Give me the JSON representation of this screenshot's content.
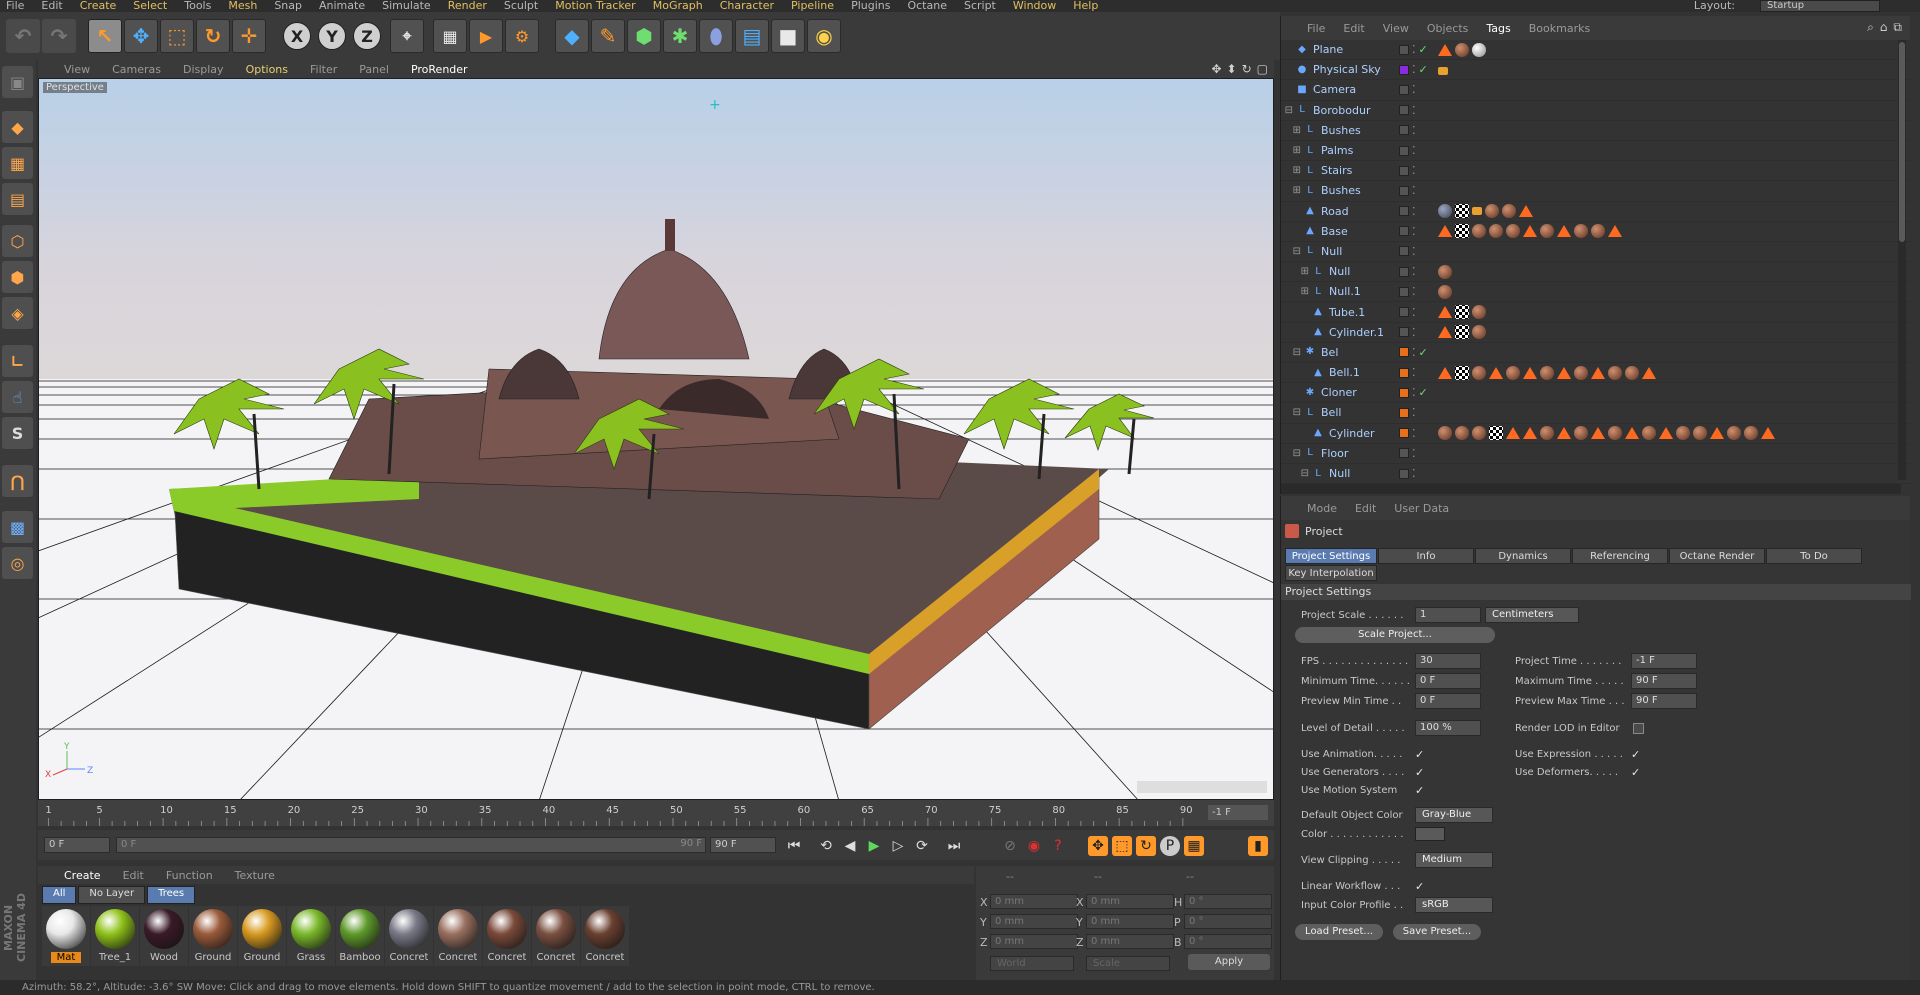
{
  "menubar": {
    "items": [
      {
        "label": "File",
        "hl": false
      },
      {
        "label": "Edit",
        "hl": false
      },
      {
        "label": "Create",
        "hl": true
      },
      {
        "label": "Select",
        "hl": true
      },
      {
        "label": "Tools",
        "hl": false
      },
      {
        "label": "Mesh",
        "hl": true
      },
      {
        "label": "Snap",
        "hl": false
      },
      {
        "label": "Animate",
        "hl": false
      },
      {
        "label": "Simulate",
        "hl": false
      },
      {
        "label": "Render",
        "hl": true
      },
      {
        "label": "Sculpt",
        "hl": false
      },
      {
        "label": "Motion Tracker",
        "hl": true
      },
      {
        "label": "MoGraph",
        "hl": true
      },
      {
        "label": "Character",
        "hl": true
      },
      {
        "label": "Pipeline",
        "hl": true
      },
      {
        "label": "Plugins",
        "hl": false
      },
      {
        "label": "Octane",
        "hl": false
      },
      {
        "label": "Script",
        "hl": false
      },
      {
        "label": "Window",
        "hl": true
      },
      {
        "label": "Help",
        "hl": true
      }
    ],
    "layout_label": "Layout:",
    "layout_value": "Startup"
  },
  "viewport": {
    "menu": [
      "View",
      "Cameras",
      "Display",
      "Options",
      "Filter",
      "Panel",
      "ProRender"
    ],
    "active_menu": "Options",
    "highlight_menu": "ProRender",
    "label": "Perspective"
  },
  "timeline": {
    "ticks": [
      "1",
      "5",
      "10",
      "15",
      "20",
      "25",
      "30",
      "35",
      "40",
      "45",
      "50",
      "55",
      "60",
      "65",
      "70",
      "75",
      "80",
      "85",
      "90"
    ],
    "frame_end": "-1 F",
    "start_field": "0 F",
    "range_start": "0 F",
    "range_end": "90 F",
    "end_field": "90 F"
  },
  "materials": {
    "menu": [
      "Create",
      "Edit",
      "Function",
      "Texture"
    ],
    "filters": [
      "All",
      "No Layer",
      "Trees"
    ],
    "items": [
      {
        "name": "Mat",
        "color": "#e8e8e8"
      },
      {
        "name": "Tree_1",
        "color": "#8fc21a"
      },
      {
        "name": "Wood",
        "color": "#3a1a28"
      },
      {
        "name": "Ground",
        "color": "#9a5a3a"
      },
      {
        "name": "Ground",
        "color": "#d89a20"
      },
      {
        "name": "Grass",
        "color": "#7ab82a"
      },
      {
        "name": "Bamboo",
        "color": "#5e9a2a"
      },
      {
        "name": "Concret",
        "color": "#7a7a88"
      },
      {
        "name": "Concret",
        "color": "#9a7060"
      },
      {
        "name": "Concret",
        "color": "#7a4a3a"
      },
      {
        "name": "Concret",
        "color": "#7a5040"
      },
      {
        "name": "Concret",
        "color": "#6a4030"
      }
    ]
  },
  "coords": {
    "header": [
      "--",
      "--",
      "--"
    ],
    "x_pos": "0 mm",
    "y_pos": "0 mm",
    "z_pos": "0 mm",
    "x_size": "0 mm",
    "y_size": "0 mm",
    "z_size": "0 mm",
    "h_rot": "0 °",
    "p_rot": "0 °",
    "b_rot": "0 °",
    "mode": "World",
    "size_mode": "Scale",
    "apply": "Apply"
  },
  "statusbar": {
    "text": "Azimuth: 58.2°, Altitude: -3.6°  SW     Move: Click and drag to move elements. Hold down SHIFT to quantize movement / add to the selection in point mode, CTRL to remove."
  },
  "objects": {
    "menu": [
      "File",
      "Edit",
      "View",
      "Objects",
      "Tags",
      "Bookmarks"
    ],
    "rows": [
      {
        "name": "Plane",
        "tree": "",
        "icon": "◆",
        "swatch": "",
        "check": "✓",
        "tags": [
          "phong",
          "mat",
          "white"
        ]
      },
      {
        "name": "Physical Sky",
        "tree": "",
        "icon": "●",
        "swatch": "#8a2be2",
        "check": "✓",
        "tags": [
          "sun"
        ]
      },
      {
        "name": "Camera",
        "tree": "",
        "icon": "■",
        "swatch": "",
        "check": "",
        "tags": []
      },
      {
        "name": "Borobodur",
        "tree": "⊟",
        "icon": "L",
        "swatch": "",
        "check": "",
        "tags": []
      },
      {
        "name": "Bushes",
        "tree": "⊞",
        "icon": "L",
        "swatch": "",
        "check": "",
        "tags": []
      },
      {
        "name": "Palms",
        "tree": "⊞",
        "icon": "L",
        "swatch": "",
        "check": "",
        "tags": []
      },
      {
        "name": "Stairs",
        "tree": "⊞",
        "icon": "L",
        "swatch": "",
        "check": "",
        "tags": []
      },
      {
        "name": "Bushes",
        "tree": "⊞",
        "icon": "L",
        "swatch": "",
        "check": "",
        "tags": []
      },
      {
        "name": "Road",
        "tree": "",
        "icon": "▲",
        "swatch": "",
        "check": "",
        "tags": [
          "grey",
          "uv",
          "sun",
          "mat",
          "mat",
          "phong"
        ]
      },
      {
        "name": "Base",
        "tree": "",
        "icon": "▲",
        "swatch": "",
        "check": "",
        "tags": [
          "phong",
          "uv",
          "mat",
          "mat",
          "mat",
          "phong",
          "mat",
          "phong",
          "mat",
          "mat",
          "phong"
        ]
      },
      {
        "name": "Null",
        "tree": "⊟",
        "icon": "L",
        "swatch": "",
        "check": "",
        "tags": []
      },
      {
        "name": "Null",
        "tree": "⊞",
        "icon": "L",
        "swatch": "",
        "check": "",
        "tags": [
          "mat"
        ]
      },
      {
        "name": "Null.1",
        "tree": "⊞",
        "icon": "L",
        "swatch": "",
        "check": "",
        "tags": [
          "mat"
        ]
      },
      {
        "name": "Tube.1",
        "tree": "",
        "icon": "▲",
        "swatch": "",
        "check": "",
        "tags": [
          "phong",
          "uv",
          "mat"
        ]
      },
      {
        "name": "Cylinder.1",
        "tree": "",
        "icon": "▲",
        "swatch": "",
        "check": "",
        "tags": [
          "phong",
          "uv",
          "mat"
        ]
      },
      {
        "name": "Bel",
        "tree": "⊟",
        "icon": "✱",
        "swatch": "#e8701a",
        "check": "✓",
        "tags": []
      },
      {
        "name": "Bell.1",
        "tree": "",
        "icon": "▲",
        "swatch": "#e8701a",
        "check": "",
        "tags": [
          "phong",
          "uv",
          "mat",
          "phong",
          "mat",
          "phong",
          "mat",
          "phong",
          "mat",
          "phong",
          "mat",
          "mat",
          "phong"
        ]
      },
      {
        "name": "Cloner",
        "tree": "",
        "icon": "✱",
        "swatch": "#e8701a",
        "check": "✓",
        "tags": []
      },
      {
        "name": "Bell",
        "tree": "⊟",
        "icon": "L",
        "swatch": "#e8701a",
        "check": "",
        "tags": []
      },
      {
        "name": "Cylinder",
        "tree": "",
        "icon": "▲",
        "swatch": "#e8701a",
        "check": "",
        "tags": [
          "mat",
          "mat",
          "mat",
          "uv",
          "phong",
          "phong",
          "mat",
          "phong",
          "mat",
          "phong",
          "mat",
          "phong",
          "mat",
          "phong",
          "mat",
          "mat",
          "phong",
          "mat",
          "mat",
          "phong"
        ]
      },
      {
        "name": "Floor",
        "tree": "⊟",
        "icon": "L",
        "swatch": "",
        "check": "",
        "tags": []
      },
      {
        "name": "Null",
        "tree": "⊟",
        "icon": "L",
        "swatch": "",
        "check": "",
        "tags": []
      }
    ]
  },
  "attributes": {
    "menu": [
      "Mode",
      "Edit",
      "User Data"
    ],
    "title": "Project",
    "tabs": [
      "Project Settings",
      "Info",
      "Dynamics",
      "Referencing",
      "Octane Render",
      "To Do",
      "Key Interpolation"
    ],
    "section": "Project Settings",
    "project_scale_label": "Project Scale . . . . . .",
    "project_scale_value": "1",
    "project_scale_unit": "Centimeters",
    "scale_project_btn": "Scale Project...",
    "fps_label": "FPS . . . . . . . . . . . . . .",
    "fps_value": "30",
    "project_time_label": "Project Time . . . . . . .",
    "project_time_value": "-1 F",
    "min_time_label": "Minimum Time. . . . . .",
    "min_time_value": "0 F",
    "max_time_label": "Maximum Time . . . . .",
    "max_time_value": "90 F",
    "preview_min_label": "Preview Min Time . .",
    "preview_min_value": "0 F",
    "preview_max_label": "Preview Max Time . . .",
    "preview_max_value": "90 F",
    "lod_label": "Level of Detail . . . . .",
    "lod_value": "100 %",
    "render_lod_label": "Render LOD in Editor",
    "use_animation_label": "Use Animation. . . . .",
    "use_expression_label": "Use Expression . . . . .",
    "use_generators_label": "Use Generators . . . .",
    "use_deformers_label": "Use Deformers. . . . .",
    "use_motion_label": "Use Motion System",
    "default_color_label": "Default Object Color",
    "default_color_value": "Gray-Blue",
    "color_label": "Color . . . . . . . . . . . .",
    "view_clipping_label": "View Clipping . . . . .",
    "view_clipping_value": "Medium",
    "linear_workflow_label": "Linear Workflow . . .",
    "input_profile_label": "Input Color Profile . .",
    "input_profile_value": "sRGB",
    "load_preset": "Load Preset...",
    "save_preset": "Save Preset..."
  },
  "brand": "MAXON CINEMA 4D"
}
